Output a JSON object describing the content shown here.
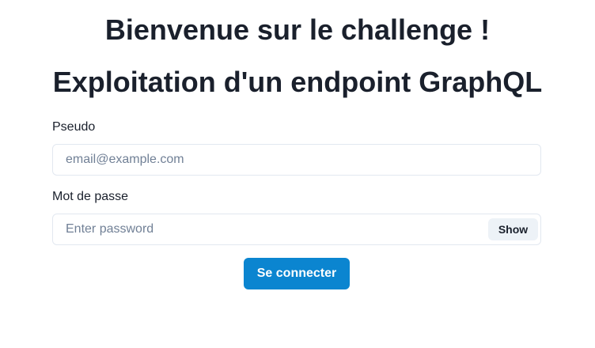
{
  "header": {
    "welcome_title": "Bienvenue sur le challenge !",
    "challenge_title": "Exploitation d'un endpoint GraphQL"
  },
  "form": {
    "pseudo": {
      "label": "Pseudo",
      "value": "",
      "placeholder": "email@example.com"
    },
    "password": {
      "label": "Mot de passe",
      "value": "",
      "placeholder": "Enter password",
      "toggle_label": "Show"
    },
    "submit_label": "Se connecter"
  },
  "colors": {
    "primary_button": "#0b85d0",
    "secondary_button": "#edf2f7",
    "input_border": "#e2e8f0",
    "text": "#1a202c",
    "placeholder": "#718096"
  }
}
